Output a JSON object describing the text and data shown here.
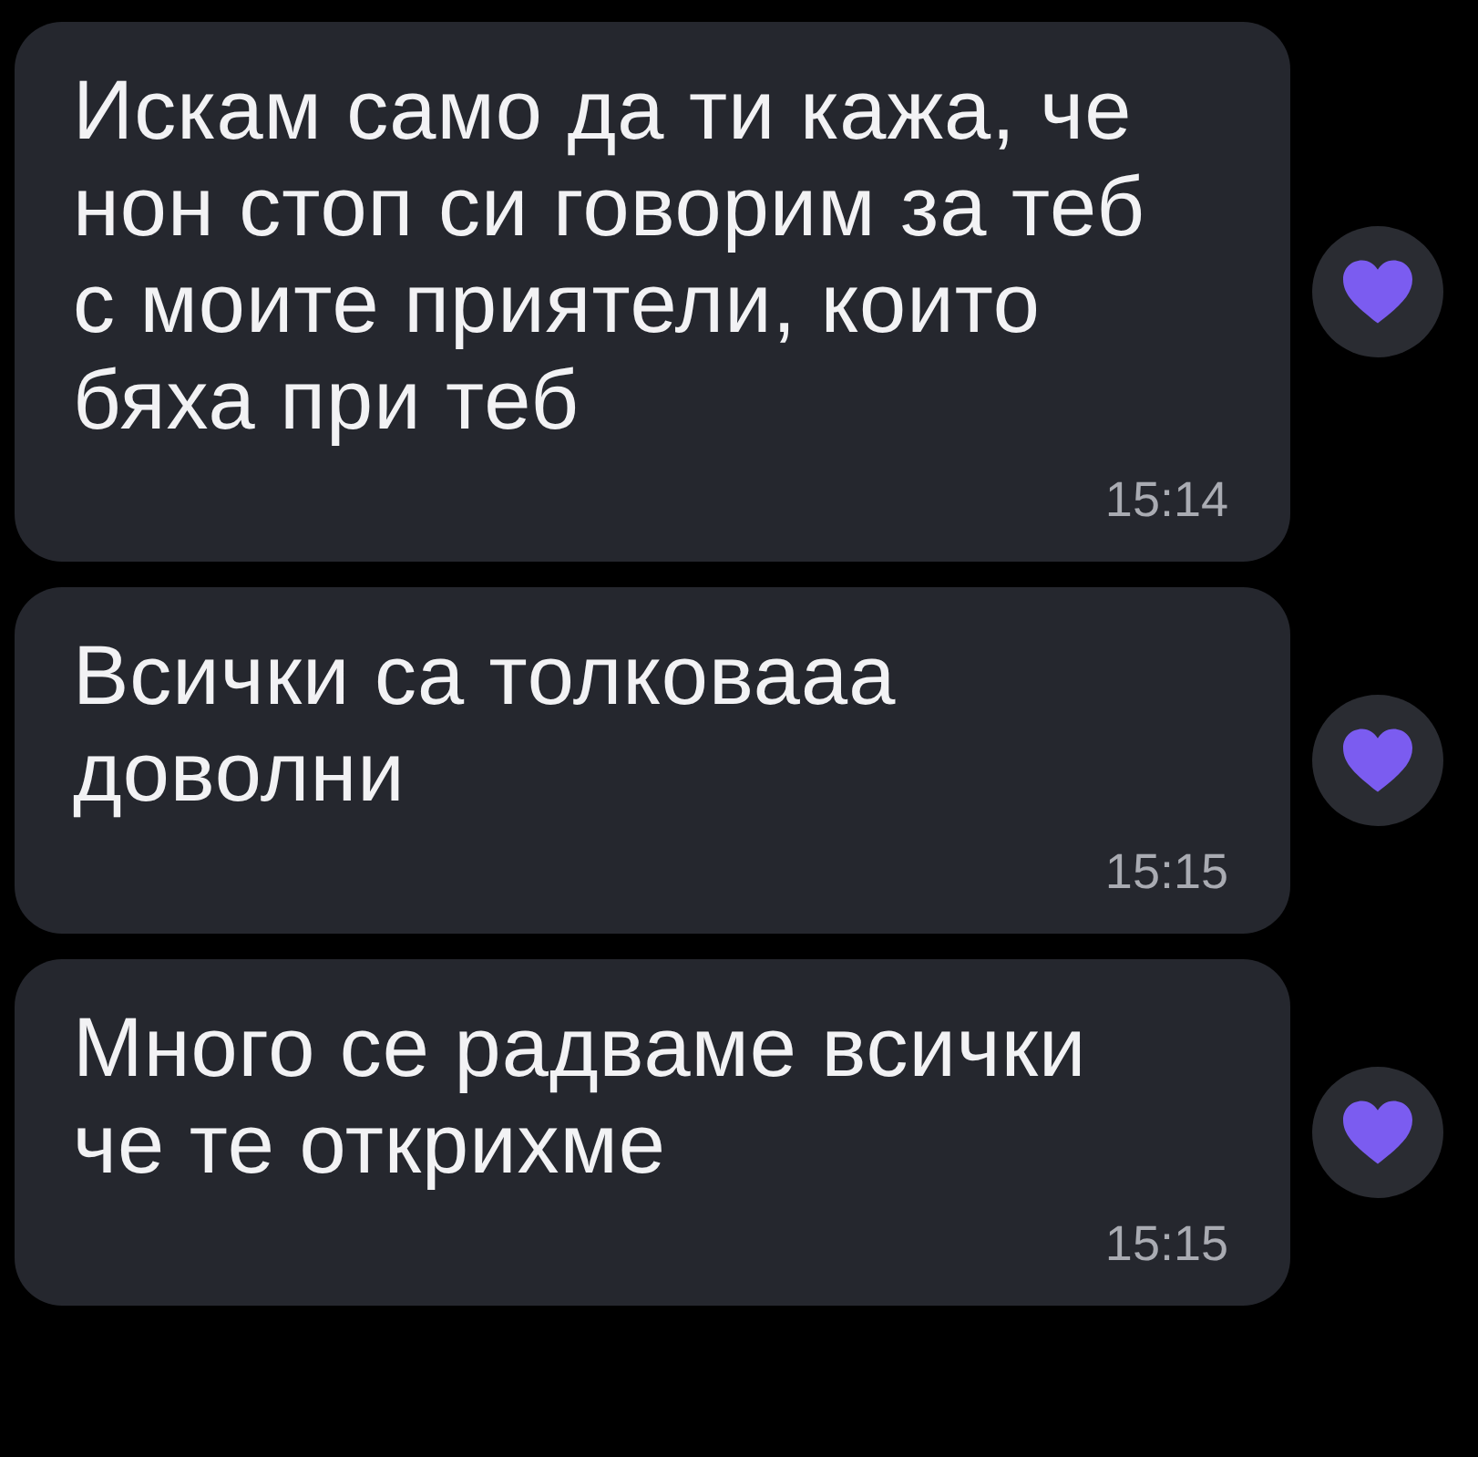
{
  "messages": [
    {
      "text": "Искам само да ти кажа, че нон стоп си говорим за теб с моите приятели, които бяха при теб",
      "time": "15:14",
      "liked": true
    },
    {
      "text": "Всички са толковааа доволни",
      "time": "15:15",
      "liked": true
    },
    {
      "text": "Много се радваме всички че те открихме",
      "time": "15:15",
      "liked": true
    }
  ]
}
